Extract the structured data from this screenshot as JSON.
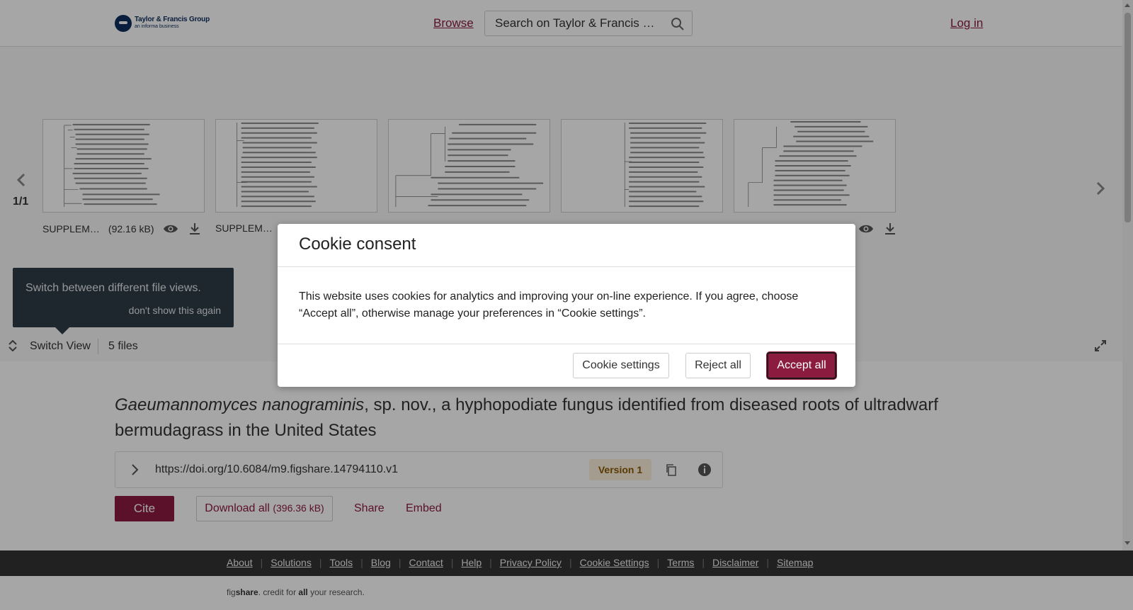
{
  "header": {
    "logo_line1": "Taylor & Francis Group",
    "logo_line2": "an informa business",
    "browse_label": "Browse",
    "search_placeholder": "Search on Taylor & Francis …",
    "login_label": "Log in"
  },
  "viewer": {
    "page_count": "1/1",
    "files": [
      {
        "name": "SUPPLEM…",
        "size": "(92.16 kB)"
      },
      {
        "name": "SUPPLEM…",
        "size": ""
      }
    ],
    "tooltip_message": "Switch between different file views.",
    "tooltip_dismiss": "don't show this again",
    "switch_view_label": "Switch View",
    "file_count": "5 files"
  },
  "article": {
    "title_italic": "Gaeumannomyces nanograminis",
    "title_rest": ", sp. nov., a hyphopodiate fungus identified from diseased roots of ultradwarf bermudagrass in the United States",
    "doi": "https://doi.org/10.6084/m9.figshare.14794110.v1",
    "version": "Version 1",
    "cite_label": "Cite",
    "download_label": "Download all",
    "download_size": "(396.36 kB)",
    "share_label": "Share",
    "embed_label": "Embed"
  },
  "footer": {
    "links": [
      "About",
      "Solutions",
      "Tools",
      "Blog",
      "Contact",
      "Help",
      "Privacy Policy",
      "Cookie Settings",
      "Terms",
      "Disclaimer",
      "Sitemap"
    ],
    "credit_fig": "fig",
    "credit_share": "share",
    "credit_mid": ". credit for ",
    "credit_all": "all",
    "credit_end": " your research."
  },
  "cookie_modal": {
    "title": "Cookie consent",
    "body": "This website uses cookies for analytics and improving your on-line experience. If you agree, choose “Accept all”, otherwise manage your preferences in “Cookie settings”.",
    "settings_label": "Cookie settings",
    "reject_label": "Reject all",
    "accept_label": "Accept all"
  },
  "colors": {
    "accent": "#8b1b3f",
    "tooltip_bg": "#2e3b47",
    "footer_bg": "#333333"
  },
  "icons": [
    "search-icon",
    "chevron-left-icon",
    "chevron-right-icon",
    "eye-icon",
    "download-icon",
    "switch-view-icon",
    "expand-icon",
    "chevron-right-icon",
    "copy-icon",
    "info-icon"
  ]
}
